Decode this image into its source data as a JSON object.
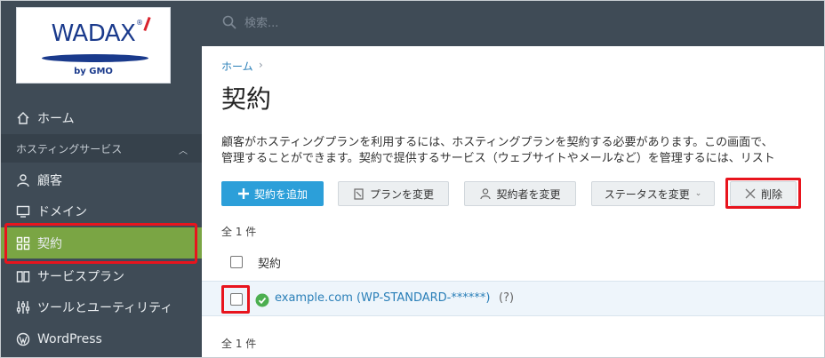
{
  "logo": {
    "brand": "WADAX",
    "sub": "by GMO",
    "reg": "®"
  },
  "search": {
    "placeholder": "検索..."
  },
  "sidebar": {
    "home": "ホーム",
    "section": "ホスティングサービス",
    "items": [
      {
        "label": "顧客",
        "icon": "user-icon"
      },
      {
        "label": "ドメイン",
        "icon": "monitor-icon"
      },
      {
        "label": "契約",
        "icon": "grid-icon"
      },
      {
        "label": "サービスプラン",
        "icon": "book-icon"
      },
      {
        "label": "ツールとユーティリティ",
        "icon": "sliders-icon"
      },
      {
        "label": "WordPress",
        "icon": "wordpress-icon"
      }
    ]
  },
  "colors": {
    "sidebar_bg": "#3f4b56",
    "active": "#7aa544",
    "primary": "#2c9fd9",
    "highlight": "#e8141d"
  },
  "main": {
    "breadcrumb": "ホーム",
    "breadcrumb_sep": "›",
    "title": "契約",
    "description_1": "顧客がホスティングプランを利用するには、ホスティングプランを契約する必要があります。この画面で、",
    "description_2": "管理することができます。契約で提供するサービス（ウェブサイトやメールなど）を管理するには、リスト",
    "toolbar": {
      "add": "契約を追加",
      "change_plan": "プランを変更",
      "change_subscriber": "契約者を変更",
      "change_status": "ステータスを変更",
      "delete": "削除"
    },
    "count_top": "全 1 件",
    "list_header": "契約",
    "rows": [
      {
        "name": "example.com (WP-STANDARD-******)",
        "help": "(?)",
        "status": "active"
      }
    ],
    "count_bottom": "全 1 件"
  }
}
